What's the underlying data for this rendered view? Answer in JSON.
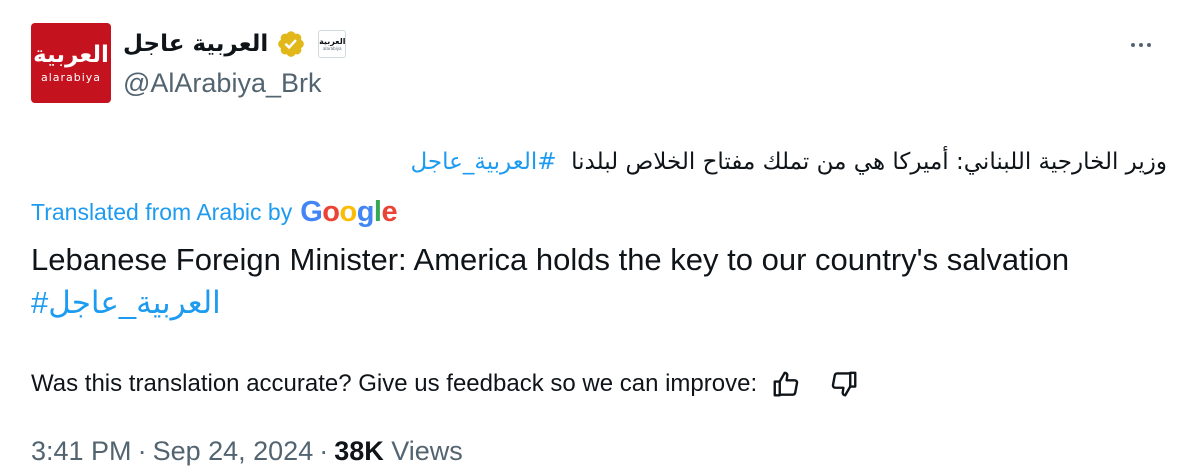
{
  "account": {
    "display_name": "العربية عاجل",
    "handle": "@AlArabiya_Brk",
    "avatar_text_ar": "العربية",
    "avatar_text_latin": "alarabiya",
    "affiliate_text_ar": "العربية",
    "affiliate_text_latin": "alarabiya"
  },
  "tweet": {
    "arabic_text": "وزير الخارجية اللبناني: أميركا هي من تملك مفتاح الخلاص لبلدنا",
    "arabic_hashtag": "#العربية_عاجل",
    "translated_label": "Translated from Arabic by",
    "google_letters": [
      "G",
      "o",
      "o",
      "g",
      "l",
      "e"
    ],
    "translation_text": "Lebanese Foreign Minister: America holds the key to our country's salvation",
    "translation_hashtag": "#العربية_عاجل",
    "feedback_text": "Was this translation accurate? Give us feedback so we can improve:"
  },
  "meta": {
    "time": "3:41 PM",
    "separator": "·",
    "date": "Sep 24, 2024",
    "views_count": "38K",
    "views_label": "Views"
  },
  "colors": {
    "brand_red": "#c4121e",
    "link_blue": "#1d9bf0",
    "verified_gold": "#e2b719",
    "muted_text": "#536471"
  },
  "icons": {
    "verified": "verified-badge-icon",
    "more": "more-options-icon",
    "thumbs_up": "thumbs-up-icon",
    "thumbs_down": "thumbs-down-icon"
  }
}
